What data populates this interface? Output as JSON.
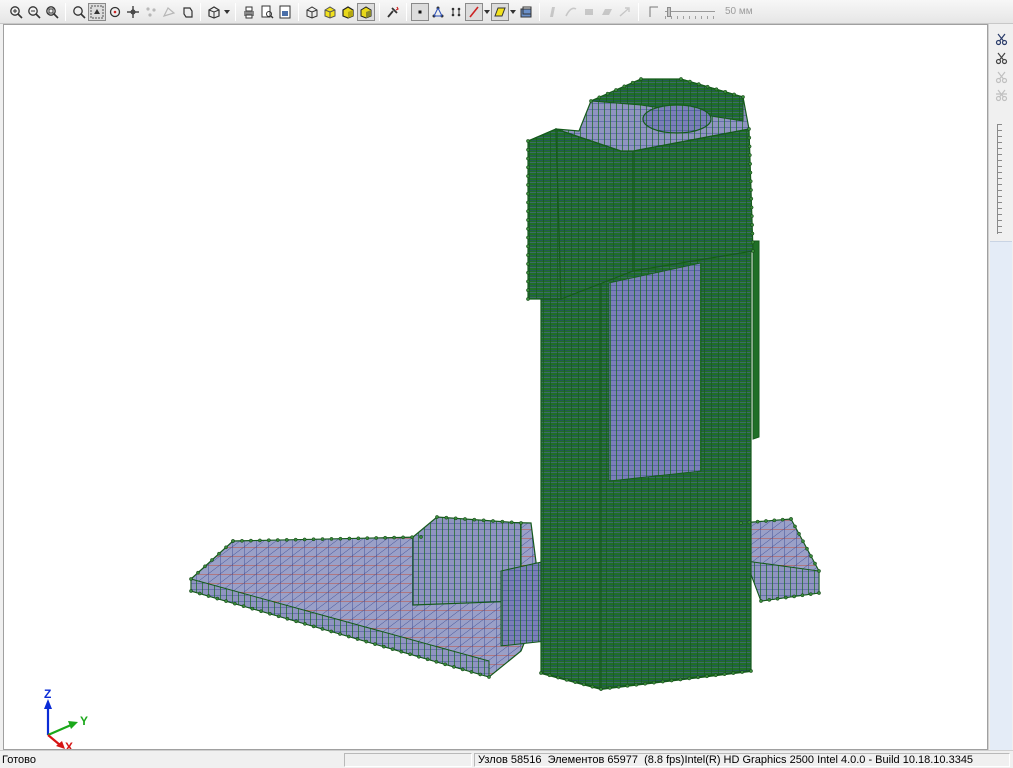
{
  "toolbar": {
    "buttons": [
      {
        "name": "zoom-in-icon"
      },
      {
        "name": "zoom-out-icon"
      },
      {
        "name": "zoom-all-icon"
      },
      {
        "name": "zoom-window-icon"
      },
      {
        "name": "pan-icon"
      },
      {
        "name": "rotate-icon"
      },
      {
        "name": "move-icon"
      },
      {
        "name": "select-nodes-icon"
      },
      {
        "name": "select-elements-icon"
      },
      {
        "name": "fragment-icon"
      }
    ],
    "size_label": "50 мм"
  },
  "axis": {
    "z": "Z",
    "y": "Y",
    "x": "X"
  },
  "status": {
    "left": "Готово",
    "nodes_label": "Узлов",
    "nodes_value": "58516",
    "elements_label": "Элементов",
    "elements_value": "65977",
    "fps": "(8.8 fps)",
    "renderer": "Intel(R) HD Graphics 2500 Intel 4.0.0 - Build 10.18.10.3345"
  },
  "colors": {
    "mesh_green": "#1f6f27",
    "mesh_dark_green": "#155a1c",
    "mesh_blue": "#2b3e8c",
    "mesh_red": "#c8452a",
    "node_fill": "#3a8a3a",
    "axis_z": "#0a2bd6",
    "axis_y": "#1aa81a",
    "axis_x": "#d61414"
  }
}
